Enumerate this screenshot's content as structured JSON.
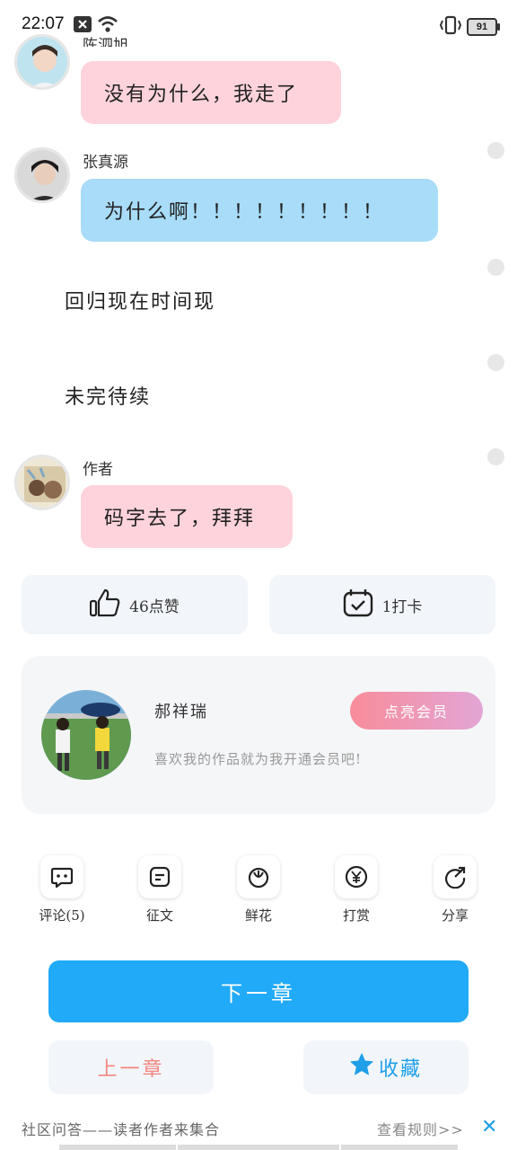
{
  "status_bar": {
    "time": "22:07",
    "battery": "91",
    "icons": [
      "notification-x-icon",
      "wifi-icon",
      "vibrate-icon",
      "battery-icon"
    ]
  },
  "chat": {
    "msg1": {
      "speaker": "陈泗旭",
      "text": "没有为什么，我走了"
    },
    "msg2": {
      "speaker": "张真源",
      "text": "为什么啊！！！！！！！！！"
    },
    "narration1": "回归现在时间现",
    "narration2": "未完待续",
    "msg3": {
      "speaker": "作者",
      "text": "码字去了，拜拜"
    }
  },
  "actions": {
    "like_label": "46点赞",
    "checkin_label": "1打卡"
  },
  "author_card": {
    "name": "郝祥瑞",
    "tip": "喜欢我的作品就为我开通会员吧!",
    "vip_button": "点亮会员"
  },
  "tools": [
    {
      "label": "评论(5)",
      "icon": "comment-icon"
    },
    {
      "label": "征文",
      "icon": "essay-icon"
    },
    {
      "label": "鲜花",
      "icon": "flower-icon"
    },
    {
      "label": "打赏",
      "icon": "yen-reward-icon"
    },
    {
      "label": "分享",
      "icon": "share-icon"
    }
  ],
  "nav": {
    "next": "下一章",
    "prev": "上一章",
    "favorite": "收藏"
  },
  "footer": {
    "text": "社区问答——读者作者来集合",
    "rules": "查看规则>>",
    "close": "✕"
  },
  "colors": {
    "pink_bubble": "#ffd3dc",
    "blue_bubble": "#a8dcf8",
    "primary": "#21aaf7",
    "prev_text": "#f4857f"
  }
}
